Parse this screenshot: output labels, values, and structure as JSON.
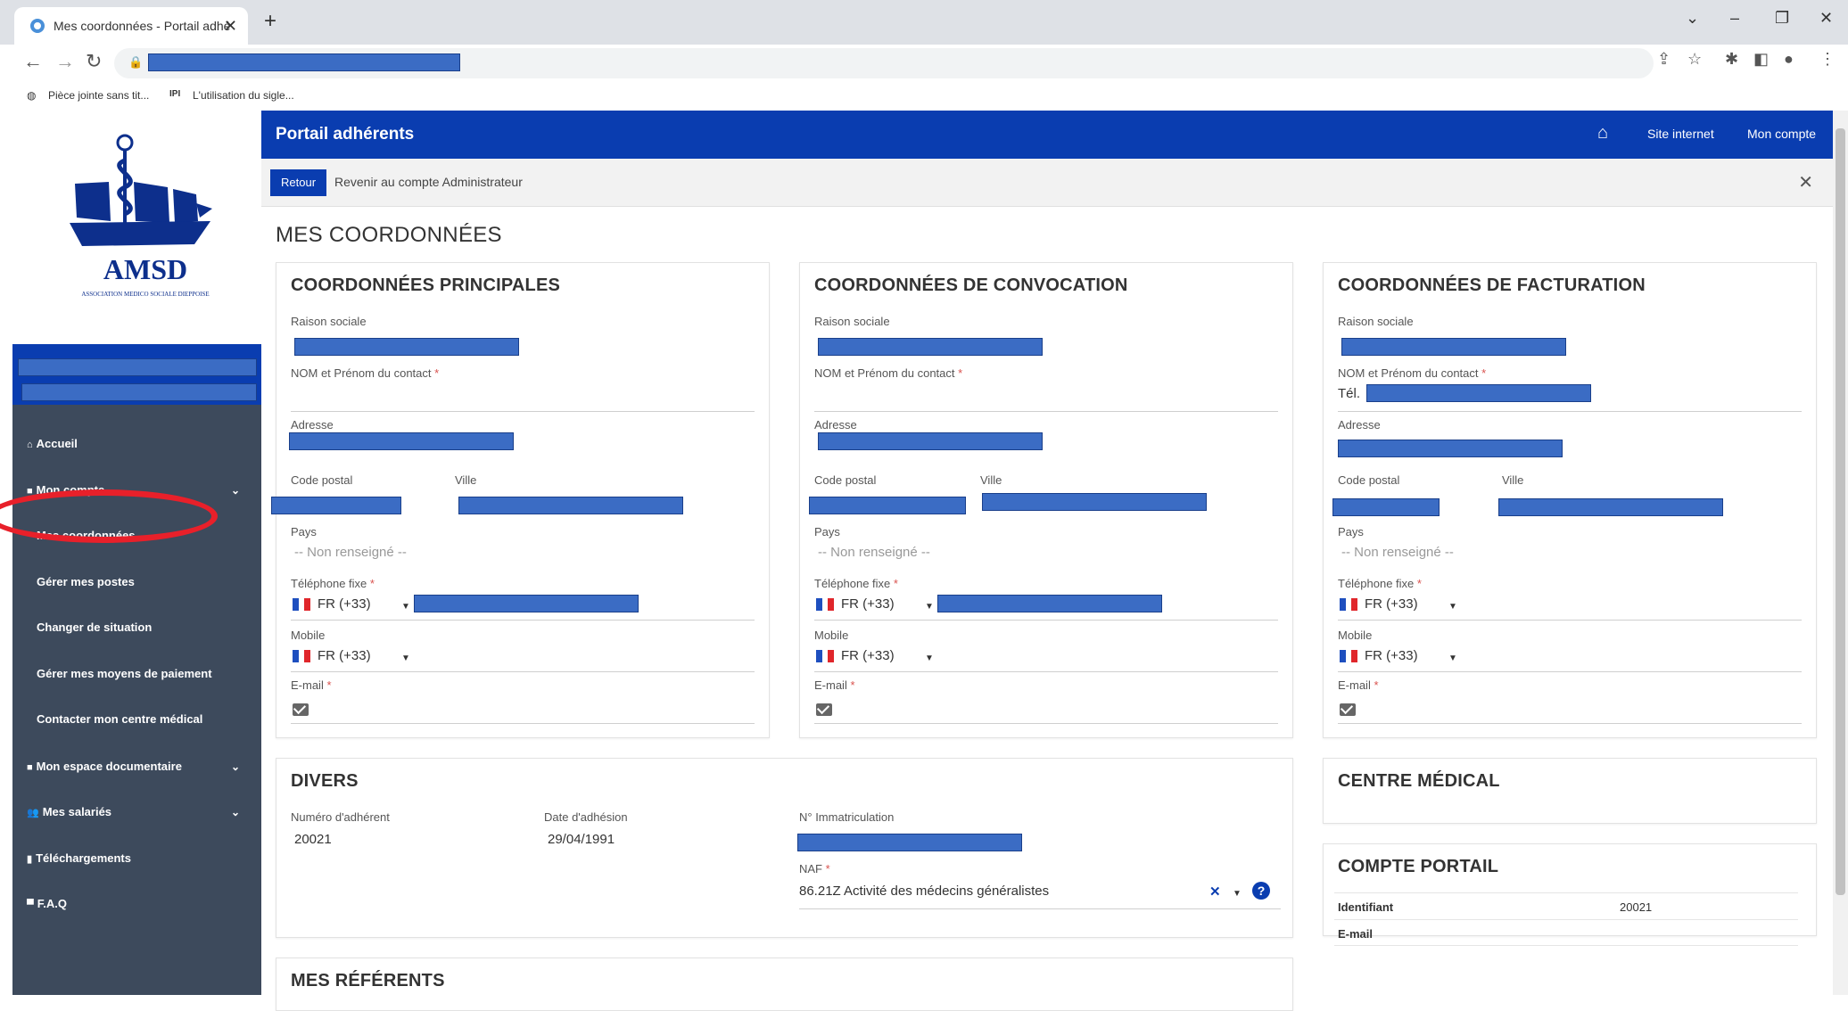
{
  "browser": {
    "tab_title": "Mes coordonnées - Portail adhé",
    "tab_close": "✕",
    "new_tab": "+",
    "bookmarks": [
      "Pièce jointe sans tit...",
      "L'utilisation du sigle..."
    ]
  },
  "logo": {
    "name": "AMSD",
    "subtitle": "ASSOCIATION MEDICO SOCIALE DIEPPOISE"
  },
  "sidebar": {
    "items": [
      {
        "label": "Accueil",
        "icon": "home-icon"
      },
      {
        "label": "Mon compte",
        "icon": "folder-icon"
      },
      {
        "label": "Mes coordonnées"
      },
      {
        "label": "Gérer mes postes"
      },
      {
        "label": "Changer de situation"
      },
      {
        "label": "Gérer mes moyens de paiement"
      },
      {
        "label": "Contacter mon centre médical"
      },
      {
        "label": "Mon espace documentaire",
        "icon": "folder-icon"
      },
      {
        "label": "Mes salariés",
        "icon": "users-icon"
      },
      {
        "label": "Téléchargements",
        "icon": "file-icon"
      },
      {
        "label": "F.A.Q",
        "icon": "comments-icon"
      }
    ]
  },
  "header": {
    "title": "Portail adhérents",
    "site_link": "Site internet",
    "account_link": "Mon compte"
  },
  "admin_bar": {
    "back_button": "Retour",
    "text": "Revenir au compte Administrateur"
  },
  "page_title": "MES COORDONNÉES",
  "labels": {
    "raison_sociale": "Raison sociale",
    "contact": "NOM et Prénom du contact",
    "adresse": "Adresse",
    "code_postal": "Code postal",
    "ville": "Ville",
    "pays": "Pays",
    "tel_fixe": "Téléphone fixe",
    "mobile": "Mobile",
    "email": "E-mail",
    "req": "*"
  },
  "country_placeholder": "-- Non renseigné --",
  "phone_prefix": "FR (+33)",
  "cards": {
    "principales": "COORDONNÉES PRINCIPALES",
    "convocation": "COORDONNÉES DE CONVOCATION",
    "facturation": "COORDONNÉES DE FACTURATION",
    "facturation_tel_prefix": "Tél."
  },
  "divers": {
    "title": "DIVERS",
    "numero_label": "Numéro d'adhérent",
    "numero_value": "20021",
    "date_label": "Date d'adhésion",
    "date_value": "29/04/1991",
    "immat_label": "N° Immatriculation",
    "naf_label": "NAF",
    "naf_value": "86.21Z Activité des médecins généralistes"
  },
  "centre_medical": {
    "title": "CENTRE MÉDICAL"
  },
  "compte_portail": {
    "title": "COMPTE PORTAIL",
    "identifiant_label": "Identifiant",
    "identifiant_value": "20021",
    "email_label": "E-mail"
  },
  "referents": {
    "title": "MES RÉFÉRENTS"
  },
  "colors": {
    "primary": "#0a3db0",
    "sidebar": "#3d4a5c",
    "redaction": "#3b6cc4",
    "highlight": "#e8202a"
  }
}
